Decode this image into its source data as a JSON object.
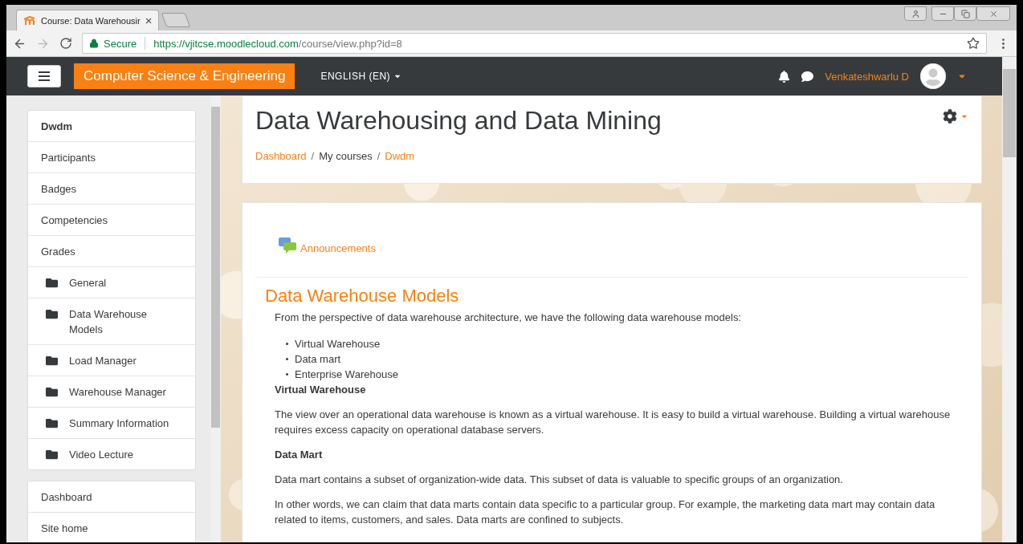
{
  "browser": {
    "tab_title": "Course: Data Warehousir",
    "tab_close": "×",
    "secure_label": "Secure",
    "url_host": "https://vjitcse.moodlecloud.com",
    "url_path": "/course/view.php?id=8",
    "forward_enabled": false
  },
  "navbar": {
    "brand": "Computer Science & Engineering",
    "language": "ENGLISH (EN)",
    "user_name": "Venkateshwarlu D"
  },
  "sidebar": {
    "sections": [
      {
        "items": [
          {
            "kind": "heading",
            "label": "Dwdm"
          },
          {
            "kind": "link",
            "label": "Participants"
          },
          {
            "kind": "link",
            "label": "Badges"
          },
          {
            "kind": "link",
            "label": "Competencies"
          },
          {
            "kind": "link",
            "label": "Grades"
          },
          {
            "kind": "folder",
            "label": "General"
          },
          {
            "kind": "folder",
            "label": "Data Warehouse Models"
          },
          {
            "kind": "folder",
            "label": "Load Manager"
          },
          {
            "kind": "folder",
            "label": "Warehouse Manager"
          },
          {
            "kind": "folder",
            "label": "Summary Information"
          },
          {
            "kind": "folder",
            "label": "Video Lecture"
          }
        ]
      },
      {
        "items": [
          {
            "kind": "link",
            "label": "Dashboard"
          },
          {
            "kind": "link",
            "label": "Site home"
          }
        ]
      }
    ]
  },
  "header": {
    "title": "Data Warehousing and Data Mining",
    "separator": "/",
    "breadcrumb": [
      {
        "label": "Dashboard",
        "link": true
      },
      {
        "label": "My courses",
        "link": false
      },
      {
        "label": "Dwdm",
        "link": true
      }
    ]
  },
  "content": {
    "announcements": "Announcements",
    "section_title": "Data Warehouse Models",
    "blocks": [
      {
        "kind": "intro",
        "text": "From the perspective of data warehouse architecture, we have the following data warehouse models:"
      },
      {
        "kind": "list",
        "items": [
          "Virtual Warehouse",
          "Data mart",
          "Enterprise Warehouse"
        ]
      },
      {
        "kind": "heading",
        "text": "Virtual Warehouse"
      },
      {
        "kind": "paragraph",
        "text": "The view over an operational data warehouse is known as a virtual warehouse. It is easy to build a virtual warehouse. Building a virtual warehouse requires excess capacity on operational database servers."
      },
      {
        "kind": "heading",
        "text": "Data Mart"
      },
      {
        "kind": "paragraph",
        "text": "Data mart contains a subset of organization-wide data. This subset of data is valuable to specific groups of an organization."
      },
      {
        "kind": "paragraph",
        "text": "In other words, we can claim that data marts contain data specific to a particular group. For example, the marketing data mart may contain data related to items, customers, and sales. Data marts are confined to subjects."
      }
    ]
  }
}
